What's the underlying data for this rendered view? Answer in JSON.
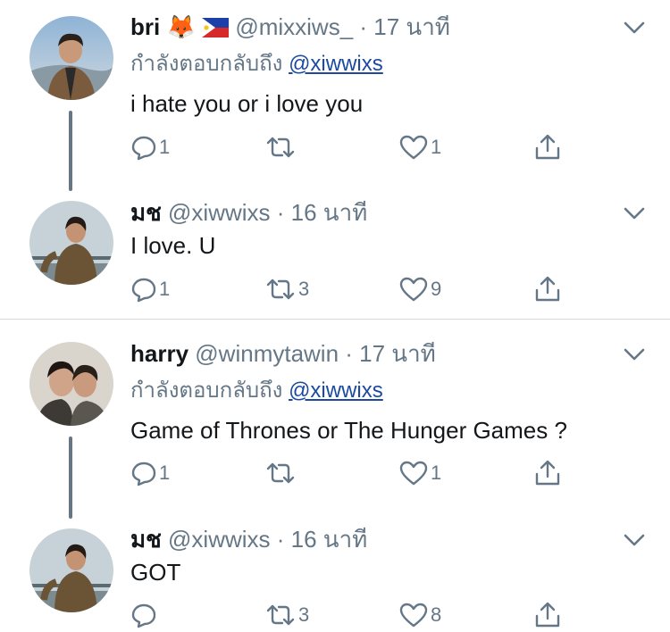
{
  "threads": [
    {
      "parent": {
        "name": "bri",
        "emoji": "🦊",
        "handle": "@mixxiws_",
        "time": "· 17 นาที",
        "reply_prefix": "กำลังตอบกลับถึง",
        "reply_to": "@xiwwixs",
        "text": "i hate you or i love you",
        "replies": "1",
        "retweets": "",
        "likes": "1"
      },
      "reply": {
        "name": "มช",
        "handle": "@xiwwixs",
        "time": "· 16 นาที",
        "text": "I love. U",
        "replies": "1",
        "retweets": "3",
        "likes": "9"
      }
    },
    {
      "parent": {
        "name": "harry",
        "handle": "@winmytawin",
        "time": "· 17 นาที",
        "reply_prefix": "กำลังตอบกลับถึง",
        "reply_to": "@xiwwixs",
        "text": "Game of Thrones or The Hunger Games ?",
        "replies": "1",
        "retweets": "",
        "likes": "1"
      },
      "reply": {
        "name": "มช",
        "handle": "@xiwwixs",
        "time": "· 16 นาที",
        "text": "GOT",
        "replies": "",
        "retweets": "3",
        "likes": "8"
      }
    }
  ],
  "icons": {
    "reply": "reply-icon",
    "retweet": "retweet-icon",
    "like": "heart-icon",
    "share": "share-icon",
    "more": "chevron-down-icon",
    "flag": "philippines-flag-icon"
  },
  "colors": {
    "text": "#14171a",
    "secondary": "#657786",
    "mention": "#1b4a9f",
    "divider": "#d6d9dc"
  }
}
